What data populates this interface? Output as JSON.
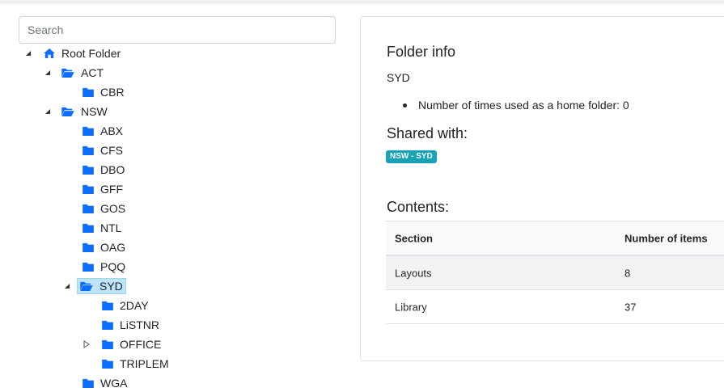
{
  "search": {
    "placeholder": "Search"
  },
  "tree": {
    "root": "Root Folder",
    "act": "ACT",
    "cbr": "CBR",
    "nsw": "NSW",
    "abx": "ABX",
    "cfs": "CFS",
    "dbo": "DBO",
    "gff": "GFF",
    "gos": "GOS",
    "ntl": "NTL",
    "oag": "OAG",
    "pqq": "PQQ",
    "syd": "SYD",
    "twoday": "2DAY",
    "listnr": "LiSTNR",
    "office": "OFFICE",
    "triplem": "TRIPLEM",
    "wga": "WGA"
  },
  "info": {
    "title": "Folder info",
    "folder_name": "SYD",
    "home_folder_text": "Number of times used as a home folder: 0",
    "shared_title": "Shared with:",
    "shared_badge": "NSW - SYD",
    "contents_title": "Contents:"
  },
  "table": {
    "headers": [
      "Section",
      "Number of items"
    ],
    "rows": [
      [
        "Layouts",
        "8"
      ],
      [
        "Library",
        "37"
      ]
    ]
  },
  "colors": {
    "folder": "#0d6efd",
    "selected_bg": "#bde3f7",
    "badge": "#17a2b8"
  }
}
